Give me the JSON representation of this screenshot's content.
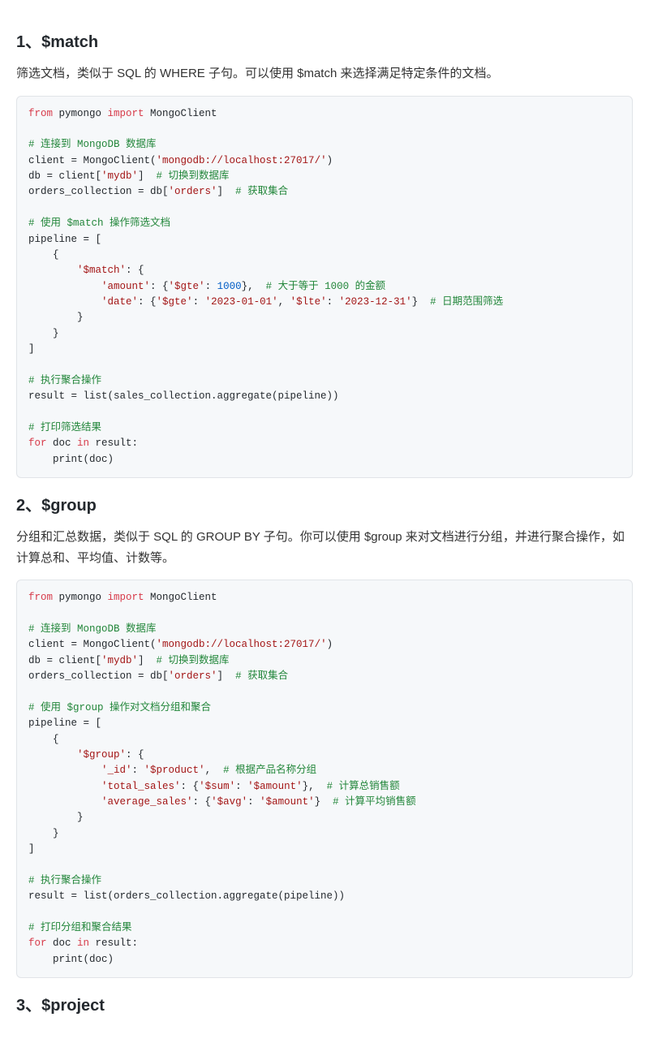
{
  "sections": [
    {
      "heading": "1、$match",
      "paragraph": "筛选文档，类似于 SQL 的 WHERE 子句。可以使用 $match 来选择满足特定条件的文档。",
      "code": {
        "l0_kw1": "from",
        "l0_mod": " pymongo ",
        "l0_kw2": "import",
        "l0_rest": " MongoClient",
        "l1_cmt": "# 连接到 MongoDB 数据库",
        "l2_a": "client = MongoClient(",
        "l2_str": "'mongodb://localhost:27017/'",
        "l2_b": ")",
        "l3_a": "db = client[",
        "l3_str": "'mydb'",
        "l3_b": "]  ",
        "l3_cmt": "# 切换到数据库",
        "l4_a": "orders_collection = db[",
        "l4_str": "'orders'",
        "l4_b": "]  ",
        "l4_cmt": "# 获取集合",
        "l5_cmt": "# 使用 $match 操作筛选文档",
        "l6": "pipeline = [",
        "l7": "    {",
        "l8_a": "        ",
        "l8_str": "'$match'",
        "l8_b": ": {",
        "l9_a": "            ",
        "l9_s1": "'amount'",
        "l9_b": ": {",
        "l9_s2": "'$gte'",
        "l9_c": ": ",
        "l9_num": "1000",
        "l9_d": "},  ",
        "l9_cmt": "# 大于等于 1000 的金额",
        "l10_a": "            ",
        "l10_s1": "'date'",
        "l10_b": ": {",
        "l10_s2": "'$gte'",
        "l10_c": ": ",
        "l10_s3": "'2023-01-01'",
        "l10_d": ", ",
        "l10_s4": "'$lte'",
        "l10_e": ": ",
        "l10_s5": "'2023-12-31'",
        "l10_f": "}  ",
        "l10_cmt": "# 日期范围筛选",
        "l11": "        }",
        "l12": "    }",
        "l13": "]",
        "l14_cmt": "# 执行聚合操作",
        "l15": "result = list(sales_collection.aggregate(pipeline))",
        "l16_cmt": "# 打印筛选结果",
        "l17_kw": "for",
        "l17_a": " doc ",
        "l17_kw2": "in",
        "l17_b": " result:",
        "l18": "    print(doc)"
      }
    },
    {
      "heading": "2、$group",
      "paragraph": "分组和汇总数据，类似于 SQL 的 GROUP BY 子句。你可以使用 $group 来对文档进行分组，并进行聚合操作，如计算总和、平均值、计数等。",
      "code": {
        "l0_kw1": "from",
        "l0_mod": " pymongo ",
        "l0_kw2": "import",
        "l0_rest": " MongoClient",
        "l1_cmt": "# 连接到 MongoDB 数据库",
        "l2_a": "client = MongoClient(",
        "l2_str": "'mongodb://localhost:27017/'",
        "l2_b": ")",
        "l3_a": "db = client[",
        "l3_str": "'mydb'",
        "l3_b": "]  ",
        "l3_cmt": "# 切换到数据库",
        "l4_a": "orders_collection = db[",
        "l4_str": "'orders'",
        "l4_b": "]  ",
        "l4_cmt": "# 获取集合",
        "l5_cmt": "# 使用 $group 操作对文档分组和聚合",
        "l6": "pipeline = [",
        "l7": "    {",
        "l8_a": "        ",
        "l8_str": "'$group'",
        "l8_b": ": {",
        "l9_a": "            ",
        "l9_s1": "'_id'",
        "l9_b": ": ",
        "l9_s2": "'$product'",
        "l9_c": ",  ",
        "l9_cmt": "# 根据产品名称分组",
        "l10_a": "            ",
        "l10_s1": "'total_sales'",
        "l10_b": ": {",
        "l10_s2": "'$sum'",
        "l10_c": ": ",
        "l10_s3": "'$amount'",
        "l10_d": "},  ",
        "l10_cmt": "# 计算总销售额",
        "l11_a": "            ",
        "l11_s1": "'average_sales'",
        "l11_b": ": {",
        "l11_s2": "'$avg'",
        "l11_c": ": ",
        "l11_s3": "'$amount'",
        "l11_d": "}  ",
        "l11_cmt": "# 计算平均销售额",
        "l12": "        }",
        "l13": "    }",
        "l14": "]",
        "l15_cmt": "# 执行聚合操作",
        "l16": "result = list(orders_collection.aggregate(pipeline))",
        "l17_cmt": "# 打印分组和聚合结果",
        "l18_kw": "for",
        "l18_a": " doc ",
        "l18_kw2": "in",
        "l18_b": " result:",
        "l19": "    print(doc)"
      }
    },
    {
      "heading": "3、$project"
    }
  ]
}
